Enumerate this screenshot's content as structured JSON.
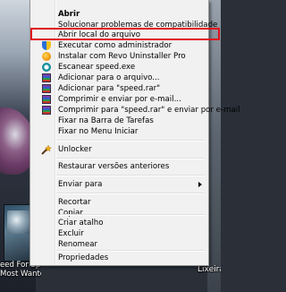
{
  "desktop": {
    "shortcut_label_line1": "eed For Speed",
    "shortcut_label_line2": "Most Wanted",
    "recycle_bin_label": "Lixeira"
  },
  "context_menu": {
    "items": [
      {
        "label": "Abrir",
        "bold": true
      },
      {
        "label": "Solucionar problemas de compatibilidade"
      },
      {
        "label": "Abrir local do arquivo",
        "highlighted": true
      },
      {
        "label": "Executar como administrador",
        "icon": "uac-shield-icon"
      },
      {
        "label": "Instalar com Revo Uninstaller Pro",
        "icon": "revo-uninstaller-icon"
      },
      {
        "label": "Escanear speed.exe",
        "icon": "eset-scan-icon"
      },
      {
        "label": "Adicionar para o arquivo...",
        "icon": "winrar-icon"
      },
      {
        "label": "Adicionar para \"speed.rar\"",
        "icon": "winrar-icon"
      },
      {
        "label": "Comprimir e enviar por e-mail...",
        "icon": "winrar-icon"
      },
      {
        "label": "Comprimir para \"speed.rar\" e enviar por e-mail",
        "icon": "winrar-icon"
      },
      {
        "label": "Fixar na Barra de Tarefas"
      },
      {
        "label": "Fixar no Menu Iniciar"
      },
      {
        "label": "Unlocker",
        "icon": "unlocker-wand-icon"
      },
      {
        "label": "Restaurar versões anteriores"
      },
      {
        "label": "Enviar para",
        "submenu": true
      },
      {
        "label": "Recortar"
      },
      {
        "label": "Copiar"
      },
      {
        "label": "Criar atalho"
      },
      {
        "label": "Excluir"
      },
      {
        "label": "Renomear"
      },
      {
        "label": "Propriedades"
      }
    ]
  },
  "colors": {
    "menu_background": "#f1f1f1",
    "highlight_border": "#e0101c"
  }
}
